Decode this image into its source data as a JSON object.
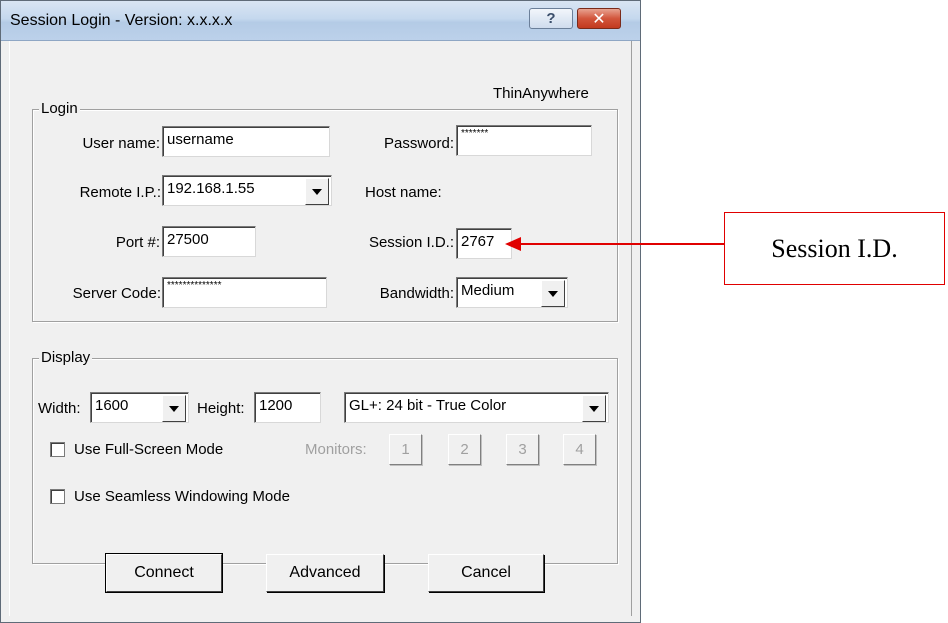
{
  "window": {
    "title": "Session Login - Version: x.x.x.x",
    "help_label": "?",
    "close_label": "✕"
  },
  "brand": "ThinAnywhere",
  "login": {
    "legend": "Login",
    "user_name_label": "User name:",
    "user_name_value": "username",
    "password_label": "Password:",
    "password_value": "*******",
    "remote_ip_label": "Remote I.P.:",
    "remote_ip_value": "192.168.1.55",
    "host_name_label": "Host name:",
    "port_label": "Port #:",
    "port_value": "27500",
    "session_id_label": "Session I.D.:",
    "session_id_value": "2767",
    "server_code_label": "Server Code:",
    "server_code_value": "**************",
    "bandwidth_label": "Bandwidth:",
    "bandwidth_value": "Medium"
  },
  "display": {
    "legend": "Display",
    "width_label": "Width:",
    "width_value": "1600",
    "height_label": "Height:",
    "height_value": "1200",
    "color_mode_value": "GL+: 24 bit - True Color",
    "fullscreen_label": "Use Full-Screen Mode",
    "fullscreen_checked": false,
    "monitors_label": "Monitors:",
    "monitors": [
      "1",
      "2",
      "3",
      "4"
    ],
    "seamless_label": "Use Seamless Windowing Mode",
    "seamless_checked": false
  },
  "buttons": {
    "connect": "Connect",
    "advanced": "Advanced",
    "cancel": "Cancel"
  },
  "callout": {
    "label": "Session I.D.",
    "color": "#e00000"
  }
}
